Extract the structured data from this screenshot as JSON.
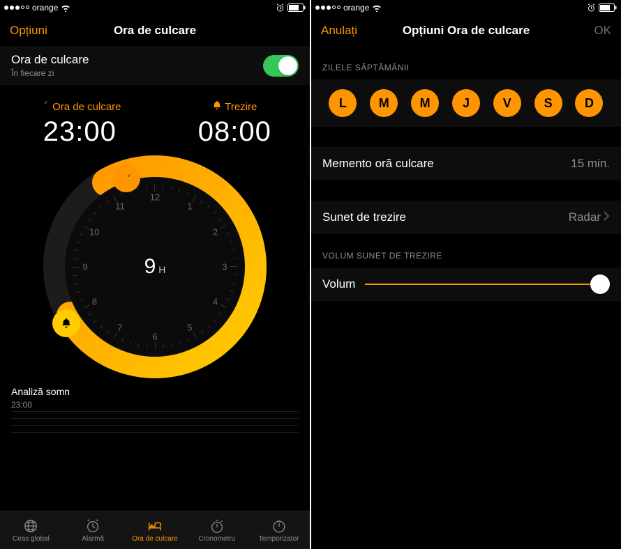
{
  "accent": "#ff9500",
  "left_screen": {
    "status": {
      "carrier": "orange"
    },
    "nav": {
      "left": "Opțiuni",
      "title": "Ora de culcare"
    },
    "toggle": {
      "title": "Ora de culcare",
      "subtitle": "În fiecare zi",
      "on": true
    },
    "bedtime": {
      "label": "Ora de culcare",
      "time": "23:00"
    },
    "wake": {
      "label": "Trezire",
      "time": "08:00"
    },
    "duration": {
      "hours": "9",
      "unit": "H"
    },
    "clock_numbers": [
      "12",
      "1",
      "2",
      "3",
      "4",
      "5",
      "6",
      "7",
      "8",
      "9",
      "10",
      "11"
    ],
    "analysis": {
      "title": "Analiză somn",
      "time": "23:00"
    },
    "tabs": [
      {
        "id": "world",
        "label": "Ceas global",
        "active": false
      },
      {
        "id": "alarm",
        "label": "Alarmă",
        "active": false
      },
      {
        "id": "bedtime",
        "label": "Ora de culcare",
        "active": true
      },
      {
        "id": "stopwatch",
        "label": "Cronometru",
        "active": false
      },
      {
        "id": "timer",
        "label": "Temporizator",
        "active": false
      }
    ]
  },
  "right_screen": {
    "status": {
      "carrier": "orange"
    },
    "nav": {
      "left": "Anulați",
      "title": "Opțiuni Ora de culcare",
      "right": "OK"
    },
    "days_header": "ZILELE SĂPTĂMÂNII",
    "days": [
      "L",
      "M",
      "M",
      "J",
      "V",
      "S",
      "D"
    ],
    "reminder": {
      "label": "Memento oră culcare",
      "value": "15 min."
    },
    "sound": {
      "label": "Sunet de trezire",
      "value": "Radar"
    },
    "volume_header": "VOLUM SUNET DE TREZIRE",
    "volume": {
      "label": "Volum",
      "value": 1.0
    }
  }
}
